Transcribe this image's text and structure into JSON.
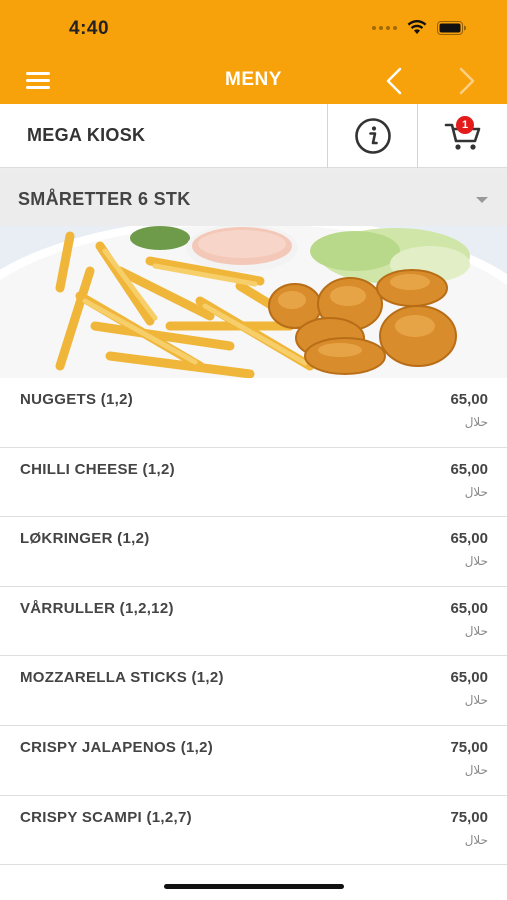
{
  "status_bar": {
    "time": "4:40",
    "icons": [
      "cellular-dots-icon",
      "wifi-icon",
      "battery-icon"
    ]
  },
  "header": {
    "title": "MENY",
    "menu_icon": "hamburger-icon",
    "back_icon": "chevron-left-icon",
    "forward_icon": "chevron-right-icon",
    "background_color": "#f7a10b"
  },
  "info_bar": {
    "store_name": "MEGA KIOSK",
    "info_icon": "info-icon",
    "cart_icon": "cart-icon",
    "cart_count": "1",
    "badge_color": "#e41b1b"
  },
  "category": {
    "label": "SMÅRETTER 6 STK",
    "caret_icon": "caret-down-icon"
  },
  "menu": {
    "items": [
      {
        "name": "NUGGETS (1,2)",
        "price": "65,00",
        "tag": "حلال"
      },
      {
        "name": "CHILLI CHEESE (1,2)",
        "price": "65,00",
        "tag": "حلال"
      },
      {
        "name": "LØKRINGER (1,2)",
        "price": "65,00",
        "tag": "حلال"
      },
      {
        "name": "VÅRRULLER (1,2,12)",
        "price": "65,00",
        "tag": "حلال"
      },
      {
        "name": "MOZZARELLA STICKS (1,2)",
        "price": "65,00",
        "tag": "حلال"
      },
      {
        "name": "CRISPY JALAPENOS (1,2)",
        "price": "75,00",
        "tag": "حلال"
      },
      {
        "name": "CRISPY SCAMPI (1,2,7)",
        "price": "75,00",
        "tag": "حلال"
      }
    ]
  }
}
